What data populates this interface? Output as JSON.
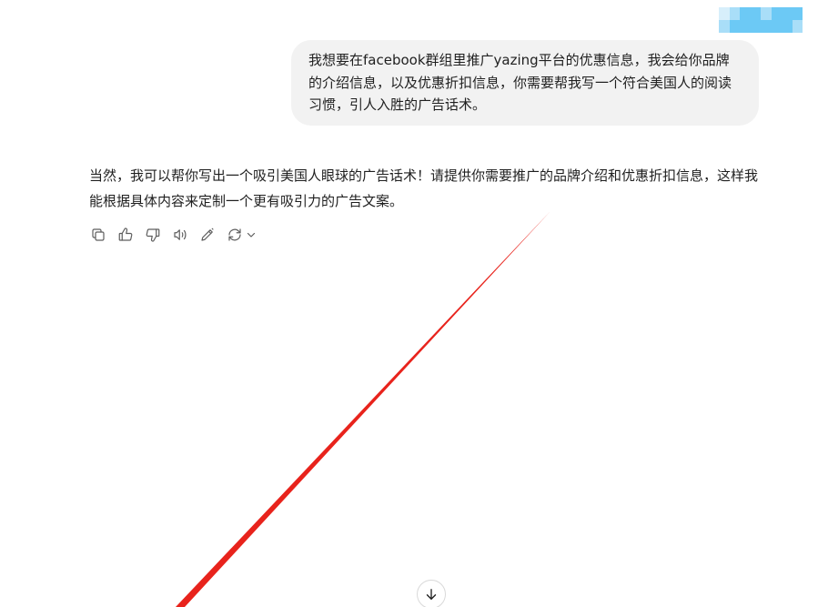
{
  "user_message": {
    "text": "我想要在facebook群组里推广yazing平台的优惠信息，我会给你品牌的介绍信息，以及优惠折扣信息，你需要帮我写一个符合美国人的阅读习惯，引人入胜的广告话术。"
  },
  "assistant_message": {
    "text": "当然，我可以帮你写出一个吸引美国人眼球的广告话术！请提供你需要推广的品牌介绍和优惠折扣信息，这样我能根据具体内容来定制一个更有吸引力的广告文案。"
  },
  "actions": {
    "icons": [
      "copy-icon",
      "thumbs-up-icon",
      "thumbs-down-icon",
      "read-aloud-icon",
      "edit-icon",
      "regenerate-icon",
      "chevron-down-icon"
    ]
  },
  "scroll_button": {
    "icon": "arrow-down-icon"
  },
  "colors": {
    "bubble_bg": "#f2f2f2",
    "text": "#1f1f1f",
    "icon": "#5d5d5d",
    "annotation": "#e8231c",
    "avatar_blur": [
      "#6cc9f5",
      "#a9def8",
      "#d7effb"
    ]
  }
}
